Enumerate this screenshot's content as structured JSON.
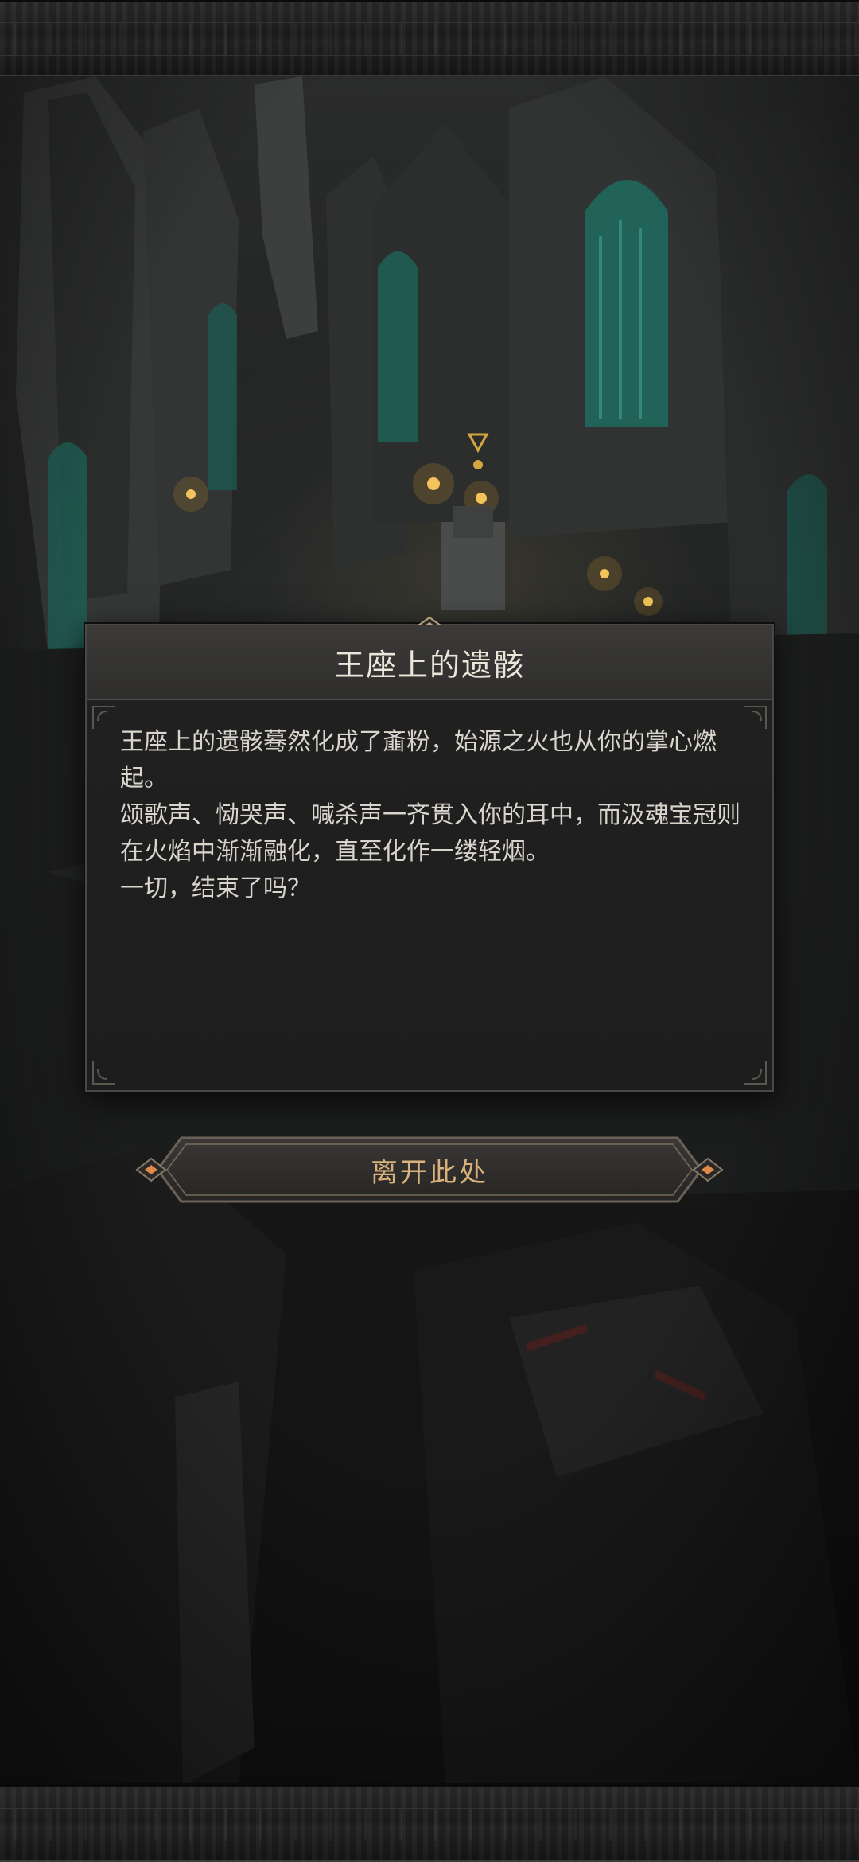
{
  "dialog": {
    "title": "王座上的遗骸",
    "paragraphs": [
      "王座上的遗骸蓦然化成了齑粉，始源之火也从你的掌心燃起。",
      "颂歌声、恸哭声、喊杀声一齐贯入你的耳中，而汲魂宝冠则在火焰中渐渐融化，直至化作一缕轻烟。",
      "一切，结束了吗？"
    ]
  },
  "actions": {
    "leave_label": "离开此处"
  },
  "colors": {
    "title_text": "#ece6da",
    "body_text": "#d9d5cc",
    "button_text": "#d8b27a",
    "button_gem": "#e08a4a",
    "window_glow": "#2f8f80"
  }
}
